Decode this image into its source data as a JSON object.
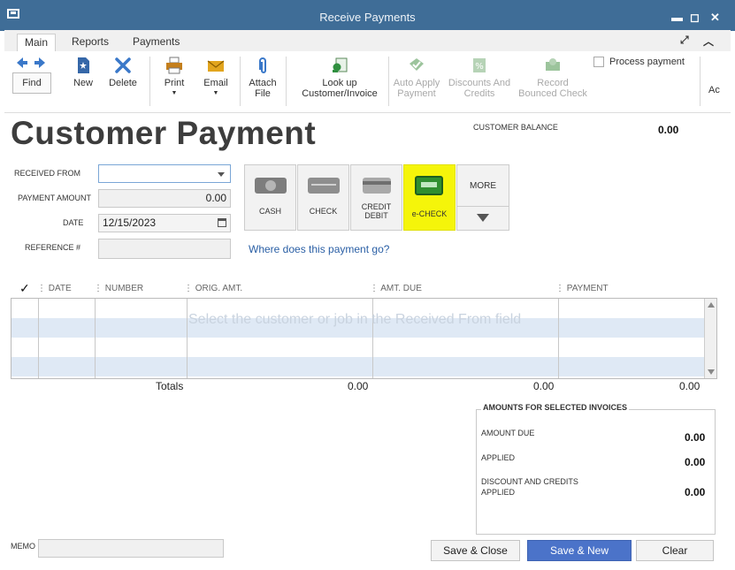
{
  "window": {
    "title": "Receive Payments",
    "controls": [
      "▬",
      "◻",
      "✕"
    ]
  },
  "tabs": [
    {
      "label": "Main",
      "active": true
    },
    {
      "label": "Reports"
    },
    {
      "label": "Payments"
    }
  ],
  "toolbar": {
    "find": "Find",
    "new": "New",
    "delete": "Delete",
    "print": "Print",
    "email": "Email",
    "attach_line1": "Attach",
    "attach_line2": "File",
    "lookup_line1": "Look up",
    "lookup_line2": "Customer/Invoice",
    "auto_apply_line1": "Auto Apply",
    "auto_apply_line2": "Payment",
    "discounts_line1": "Discounts And",
    "discounts_line2": "Credits",
    "record_line1": "Record",
    "record_line2": "Bounced Check",
    "process_payment": "Process payment",
    "overflow": "Ac"
  },
  "form": {
    "heading": "Customer Payment",
    "customer_balance_label": "CUSTOMER BALANCE",
    "customer_balance_value": "0.00",
    "received_from_label": "RECEIVED FROM",
    "received_from_value": "",
    "payment_amount_label": "PAYMENT AMOUNT",
    "payment_amount_value": "0.00",
    "date_label": "DATE",
    "date_value": "12/15/2023",
    "reference_label": "REFERENCE #",
    "reference_value": "",
    "where_link": "Where does this payment go?"
  },
  "payment_methods": [
    {
      "label": "CASH"
    },
    {
      "label": "CHECK"
    },
    {
      "label_line1": "CREDIT",
      "label_line2": "DEBIT"
    },
    {
      "label": "e-CHECK",
      "highlighted": true
    },
    {
      "label": "MORE"
    }
  ],
  "table": {
    "headers": [
      "✓",
      "DATE",
      "NUMBER",
      "ORIG. AMT.",
      "AMT. DUE",
      "PAYMENT"
    ],
    "placeholder": "Select the customer or job in the Received From field",
    "totals_label": "Totals",
    "totals_orig": "0.00",
    "totals_due": "0.00",
    "totals_payment": "0.00"
  },
  "amounts": {
    "title": "AMOUNTS FOR SELECTED INVOICES",
    "amount_due_label": "AMOUNT DUE",
    "amount_due_value": "0.00",
    "applied_label": "APPLIED",
    "applied_value": "0.00",
    "discounts_line1": "DISCOUNT AND CREDITS",
    "discounts_line2": "APPLIED",
    "discounts_value": "0.00"
  },
  "memo_label": "MEMO",
  "buttons": {
    "save_close": "Save & Close",
    "save_new": "Save & New",
    "clear": "Clear"
  },
  "colors": {
    "titlebar": "#3f6d97",
    "highlight": "#f5f50a",
    "primary_button": "#4b73c9",
    "link": "#2a5fa5"
  }
}
